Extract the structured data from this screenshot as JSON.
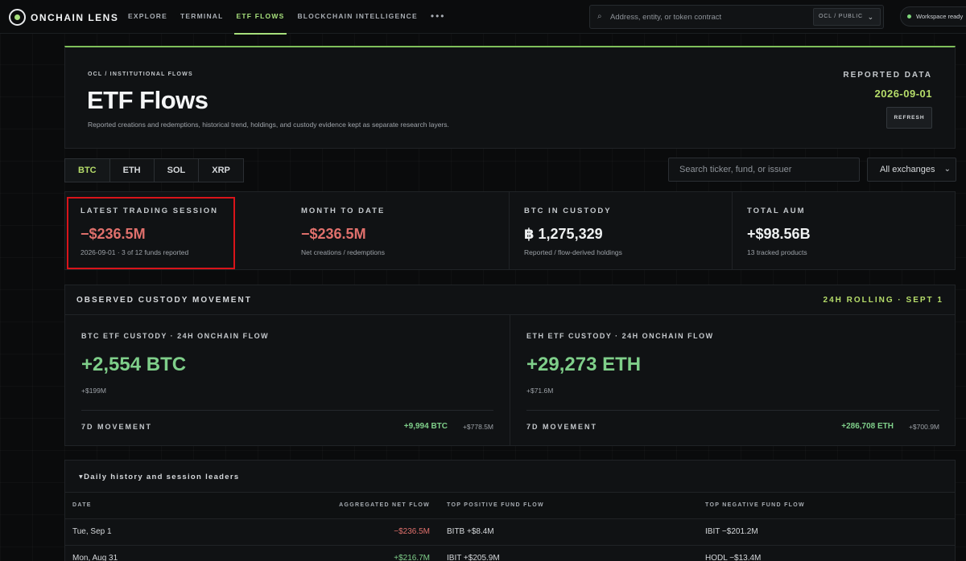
{
  "app": {
    "logo_text": "ONCHAIN LENS",
    "nav": [
      "EXPLORE",
      "TERMINAL",
      "ETF FLOWS",
      "BLOCKCHAIN INTELLIGENCE"
    ],
    "nav_more": "•••",
    "search_placeholder": "Address, entity, or token contract",
    "scope_select": "OCL / PUBLIC",
    "workspace_status": "Workspace ready"
  },
  "hero": {
    "eyebrow": "OCL / INSTITUTIONAL FLOWS",
    "title": "ETF Flows",
    "subtitle": "Reported creations and redemptions, historical trend, holdings, and custody evidence kept as separate research layers.",
    "reported_label": "REPORTED DATA",
    "reported_date": "2026-09-01",
    "refresh_label": "REFRESH"
  },
  "tabs": [
    "BTC",
    "ETH",
    "SOL",
    "XRP"
  ],
  "filters": {
    "search_placeholder": "Search ticker, fund, or issuer",
    "exchange": "All exchanges"
  },
  "stats": [
    {
      "label": "LATEST TRADING SESSION",
      "value": "−$236.5M",
      "sub": "2026-09-01 · 3 of 12 funds reported",
      "tone": "neg"
    },
    {
      "label": "MONTH TO DATE",
      "value": "−$236.5M",
      "sub": "Net creations / redemptions",
      "tone": "neg"
    },
    {
      "label": "BTC IN CUSTODY",
      "value": "฿ 1,275,329",
      "sub": "Reported / flow-derived holdings",
      "tone": "white"
    },
    {
      "label": "TOTAL AUM",
      "value": "+$98.56B",
      "sub": "13 tracked products",
      "tone": "white"
    }
  ],
  "custody": {
    "title": "OBSERVED CUSTODY MOVEMENT",
    "tag": "24H ROLLING · SEPT 1",
    "panels": [
      {
        "label": "BTC ETF CUSTODY · 24H ONCHAIN FLOW",
        "value": "+2,554 BTC",
        "usd": "+$199M",
        "m7_label": "7D MOVEMENT",
        "m7_value": "+9,994 BTC",
        "m7_usd": "+$778.5M"
      },
      {
        "label": "ETH ETF CUSTODY · 24H ONCHAIN FLOW",
        "value": "+29,273 ETH",
        "usd": "+$71.6M",
        "m7_label": "7D MOVEMENT",
        "m7_value": "+286,708 ETH",
        "m7_usd": "+$700.9M"
      }
    ]
  },
  "history": {
    "toggle": "▾Daily history and session leaders",
    "columns": [
      "DATE",
      "AGGREGATED NET FLOW",
      "TOP POSITIVE FUND FLOW",
      "TOP NEGATIVE FUND FLOW"
    ],
    "rows": [
      {
        "date": "Tue, Sep 1",
        "agg": "−$236.5M",
        "tone": "neg",
        "top": "BITB +$8.4M",
        "neg": "IBIT −$201.2M"
      },
      {
        "date": "Mon, Aug 31",
        "agg": "+$216.7M",
        "tone": "pos",
        "top": "IBIT +$205.9M",
        "neg": "HODL −$13.4M"
      }
    ]
  }
}
